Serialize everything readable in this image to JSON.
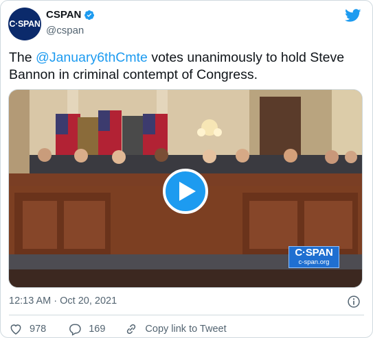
{
  "author": {
    "avatar_text": "C·SPAN",
    "display_name": "CSPAN",
    "handle": "@cspan"
  },
  "tweet": {
    "text_prefix": "The ",
    "mention": "@January6thCmte",
    "text_suffix": " votes unanimously to hold Steve Bannon in criminal contempt of Congress."
  },
  "media": {
    "watermark_brand": "C·SPAN",
    "watermark_url": "c-span.org"
  },
  "meta": {
    "timestamp": "12:13 AM · Oct 20, 2021"
  },
  "actions": {
    "likes": "978",
    "replies": "169",
    "copy_link_label": "Copy link to Tweet"
  },
  "colors": {
    "accent": "#1d9bf0",
    "avatar_bg": "#0b2a6b",
    "text_secondary": "#536471"
  },
  "icons": [
    "verified-badge-icon",
    "twitter-bird-icon",
    "play-icon",
    "info-icon",
    "heart-icon",
    "reply-icon",
    "link-icon"
  ]
}
